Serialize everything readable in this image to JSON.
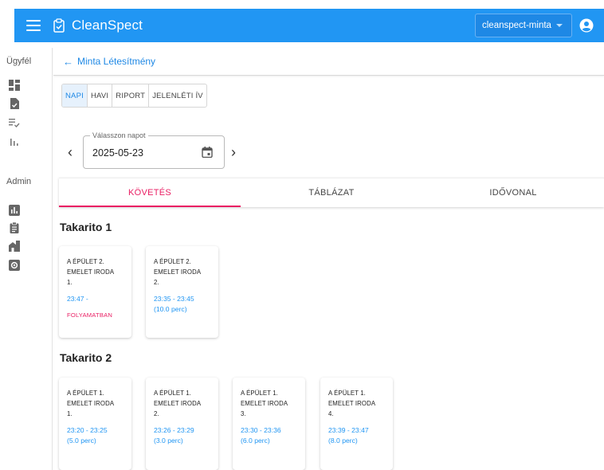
{
  "app": {
    "title": "CleanSpect",
    "tenant": "cleanspect-minta"
  },
  "rail": {
    "section_client": "Ügyfél",
    "section_admin": "Admin",
    "client_icons": [
      "dashboard-icon",
      "document-check-icon",
      "checklist-icon",
      "bar-chart-icon"
    ],
    "admin_icons": [
      "analytics-icon",
      "clipboard-icon",
      "buildings-icon",
      "settings-box-icon"
    ]
  },
  "header": {
    "back_arrow": "←",
    "back_label": "Minta Létesítmény"
  },
  "modes": [
    {
      "label": "NAPI",
      "active": true
    },
    {
      "label": "HAVI",
      "active": false
    },
    {
      "label": "RIPORT",
      "active": false
    },
    {
      "label": "JELENLÉTI ÍV",
      "active": false
    }
  ],
  "date_picker": {
    "legend": "Válasszon napot",
    "value": "2025-05-23",
    "prev": "‹",
    "next": "›"
  },
  "tabs": [
    {
      "label": "KÖVETÉS",
      "active": true
    },
    {
      "label": "TÁBLÁZAT",
      "active": false
    },
    {
      "label": "IDŐVONAL",
      "active": false
    }
  ],
  "groups": [
    {
      "title": "Takarito 1",
      "cards": [
        {
          "line1": "A ÉPÜLET 2.",
          "line2": "EMELET IRODA",
          "line3": "1.",
          "time": "23:47 -",
          "duration": "",
          "status": "FOLYAMATBAN"
        },
        {
          "line1": "A ÉPÜLET 2.",
          "line2": "EMELET IRODA",
          "line3": "2.",
          "time": "23:35 - 23:45",
          "duration": "(10.0 perc)",
          "status": ""
        }
      ]
    },
    {
      "title": "Takarito 2",
      "cards": [
        {
          "line1": "A ÉPÜLET 1.",
          "line2": "EMELET IRODA",
          "line3": "1.",
          "time": "23:20 - 23:25",
          "duration": "(5.0 perc)",
          "status": ""
        },
        {
          "line1": "A ÉPÜLET 1.",
          "line2": "EMELET IRODA",
          "line3": "2.",
          "time": "23:26 - 23:29",
          "duration": "(3.0 perc)",
          "status": ""
        },
        {
          "line1": "A ÉPÜLET 1.",
          "line2": "EMELET IRODA",
          "line3": "3.",
          "time": "23:30 - 23:36",
          "duration": "(6.0 perc)",
          "status": ""
        },
        {
          "line1": "A ÉPÜLET 1.",
          "line2": "EMELET IRODA",
          "line3": "4.",
          "time": "23:39 - 23:47",
          "duration": "(8.0 perc)",
          "status": ""
        }
      ]
    }
  ],
  "colors": {
    "primary": "#2196f3",
    "accent": "#e91e63"
  }
}
